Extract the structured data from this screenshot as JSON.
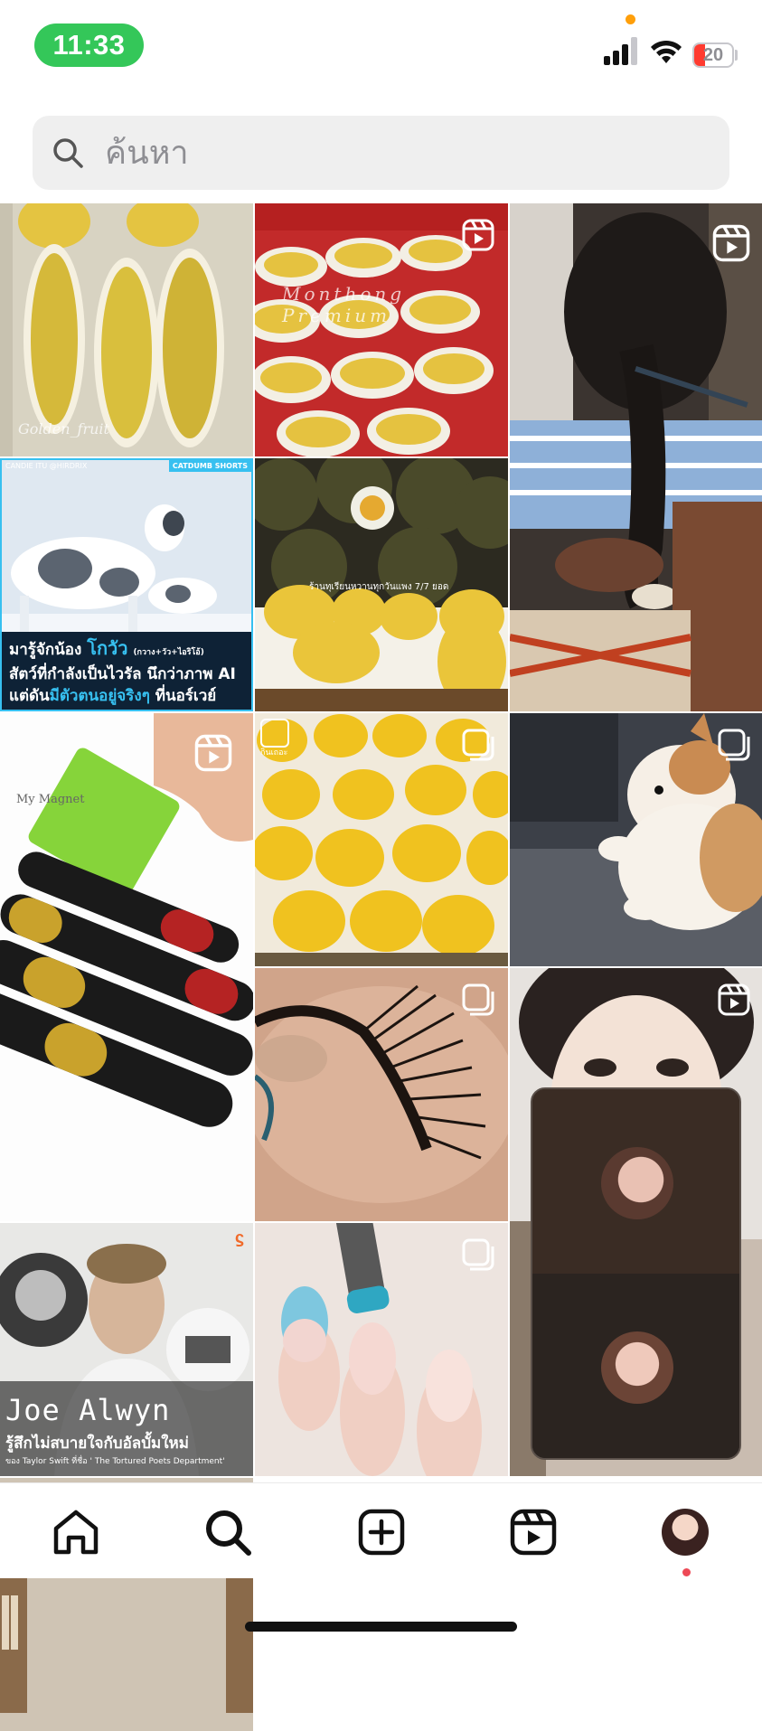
{
  "status_bar": {
    "time": "11:33",
    "battery_level": "20",
    "icons": [
      "mic-indicator-dot",
      "signal-icon",
      "wifi-icon",
      "battery-icon"
    ]
  },
  "search": {
    "placeholder": "ค้นหา",
    "value": ""
  },
  "grid": {
    "tiles": [
      {
        "id": "durian-tray",
        "watermark": "Golden_fruit",
        "badge": null
      },
      {
        "id": "durian-crate",
        "watermark": "Monthong Premium",
        "badge": "reel"
      },
      {
        "id": "hair-braid",
        "badge": "reel"
      },
      {
        "id": "cow-deer",
        "top_left": "CANDIE ITU @HIRDRIX",
        "top_right": "CATDUMB SHORTS",
        "line1_a": "มารู้จักน้อง",
        "line1_b": "โกวัว",
        "line1_c": "(กวาง+วัว+ไอริโอ้)",
        "line2": "สัตว์ที่กำลังเป็นไวรัล นึกว่าภาพ AI",
        "line3_a": "แต่ดัน",
        "line3_b": "มีตัวตนอยู่จริงๆ",
        "line3_c": "ที่นอร์เวย์"
      },
      {
        "id": "durian-market",
        "caption": "ร้านทุเรียนหวานทุกวันแพง 7/7 ยอด",
        "badge": null
      },
      {
        "id": "magnet-card",
        "label": "My Magnet",
        "badge": "reel"
      },
      {
        "id": "durian-rows",
        "corner_label": "กินเถอะ",
        "badge": "carousel"
      },
      {
        "id": "corgi",
        "badge": "carousel"
      },
      {
        "id": "eyelash",
        "badge": "carousel"
      },
      {
        "id": "makeup-girl",
        "badge": "reel"
      },
      {
        "id": "joe-alwyn",
        "name": "Joe Alwyn",
        "line1": "รู้สึกไม่สบายใจกับอัลบั้มใหม่",
        "line2": "ของ Taylor Swift ที่ชื่อ ' The Tortured Poets Department'"
      },
      {
        "id": "nails",
        "badge": "carousel"
      },
      {
        "id": "bookshelf",
        "badge": null
      }
    ]
  },
  "mini_player": {
    "participants": 2
  },
  "tab_bar": {
    "tabs": [
      "home-icon",
      "search-icon",
      "create-icon",
      "reels-icon",
      "profile-avatar"
    ],
    "active": "search"
  },
  "colors": {
    "accent_green": "#34c759",
    "battery_red": "#ff3b30",
    "notification_red": "#ed4956",
    "reel_cyan": "#37c0f0"
  }
}
